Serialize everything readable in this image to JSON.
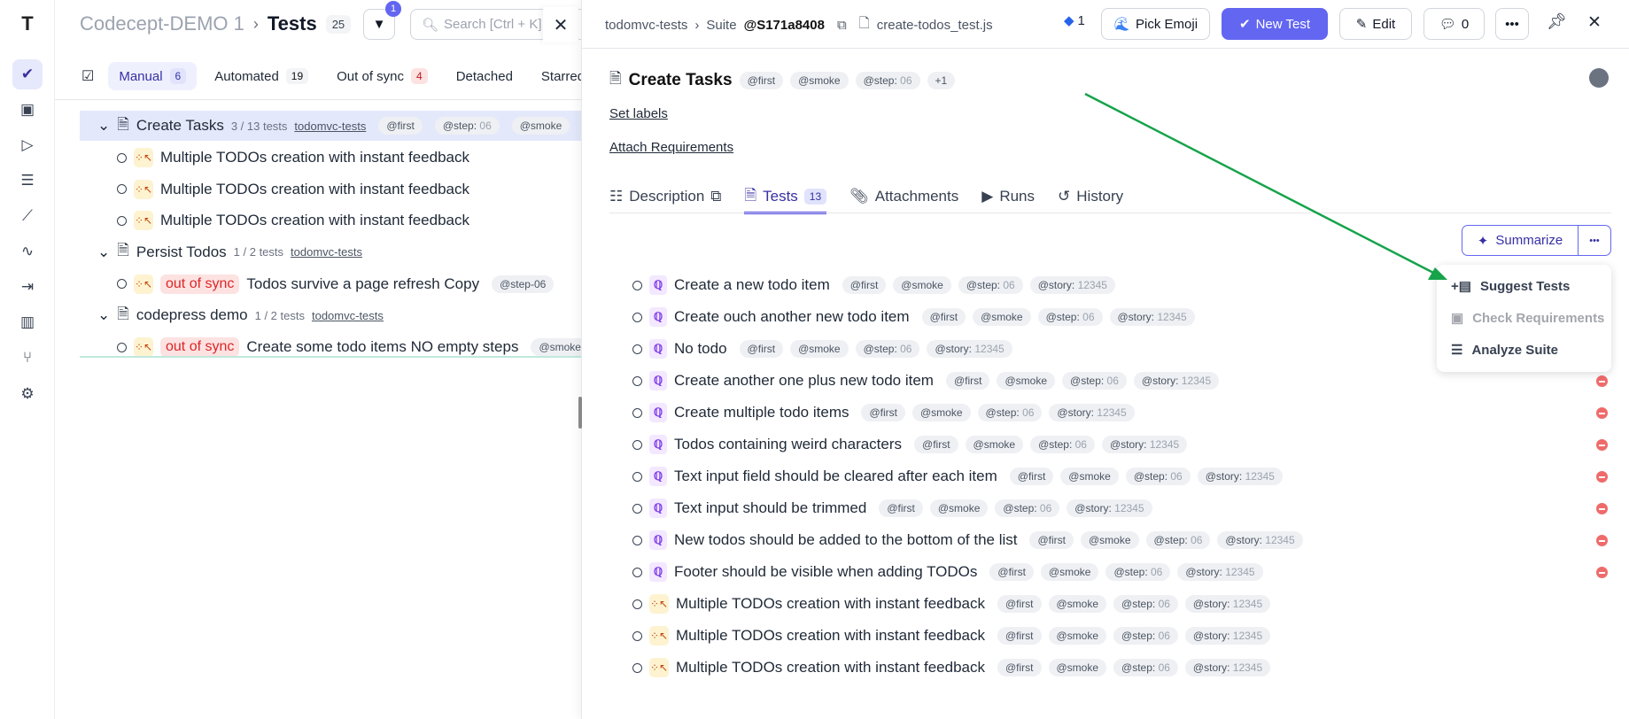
{
  "sidebar": {
    "items": [
      "logo",
      "tests",
      "suites",
      "runs",
      "plans",
      "steps",
      "analytics",
      "import",
      "reports",
      "branches",
      "settings"
    ]
  },
  "left": {
    "project": "Codecept-DEMO 1",
    "separator": "›",
    "title": "Tests",
    "count": "25",
    "filter_badge": "1",
    "search_placeholder": "Search [Ctrl + K]",
    "tabs": [
      {
        "label": "Manual",
        "count": "6"
      },
      {
        "label": "Automated",
        "count": "19"
      },
      {
        "label": "Out of sync",
        "count": "4"
      },
      {
        "label": "Detached"
      },
      {
        "label": "Starred"
      }
    ],
    "suites": [
      {
        "name": "Create Tasks",
        "meta": "3 / 13 tests",
        "link": "todomvc-tests",
        "tags": [
          [
            "@first",
            ""
          ],
          [
            "@step:",
            " 06"
          ],
          [
            "@smoke",
            ""
          ]
        ],
        "tests": [
          {
            "name": "Multiple TODOs creation with instant feedback"
          },
          {
            "name": "Multiple TODOs creation with instant feedback"
          },
          {
            "name": "Multiple TODOs creation with instant feedback"
          }
        ]
      },
      {
        "name": "Persist Todos",
        "meta": "1 / 2 tests",
        "link": "todomvc-tests",
        "tags": [],
        "tests": [
          {
            "name": "Todos survive a page refresh Copy",
            "oos": "out of sync",
            "tag": "@step-06"
          }
        ]
      },
      {
        "name": "codepress demo",
        "meta": "1 / 2 tests",
        "link": "todomvc-tests",
        "tags": [],
        "tests": [
          {
            "name": "Create some todo items NO empty steps",
            "oos": "out of sync",
            "tag": "@smoke"
          }
        ]
      }
    ]
  },
  "right": {
    "breadcrumb": {
      "project": "todomvc-tests",
      "suite_prefix": "Suite",
      "suite_id": "@S171a8408",
      "file": "create-todos_test.js"
    },
    "jira_count": "1",
    "pick_emoji": "Pick Emoji",
    "new_test": "New Test",
    "edit": "Edit",
    "comments": "0",
    "title": "Create Tasks",
    "title_tags": [
      [
        "@first",
        ""
      ],
      [
        "@smoke",
        ""
      ],
      [
        "@step:",
        " 06"
      ],
      [
        "+1",
        ""
      ]
    ],
    "set_labels": "Set labels",
    "attach_requirements": "Attach Requirements",
    "tabs": [
      {
        "label": "Description"
      },
      {
        "label": "Tests",
        "count": "13"
      },
      {
        "label": "Attachments"
      },
      {
        "label": "Runs"
      },
      {
        "label": "History"
      }
    ],
    "summarize": "Summarize",
    "menu": [
      {
        "label": "Suggest Tests",
        "disabled": false
      },
      {
        "label": "Check Requirements",
        "disabled": true
      },
      {
        "label": "Analyze Suite",
        "disabled": false
      }
    ],
    "tests": [
      {
        "name": "Create a new todo item",
        "type": "auto",
        "del": false
      },
      {
        "name": "Create ouch another new todo item",
        "type": "auto",
        "del": false
      },
      {
        "name": "No todo",
        "type": "auto",
        "del": false
      },
      {
        "name": "Create another one plus new todo item",
        "type": "auto",
        "del": true
      },
      {
        "name": "Create multiple todo items",
        "type": "auto",
        "del": true
      },
      {
        "name": "Todos containing weird characters",
        "type": "auto",
        "del": true
      },
      {
        "name": "Text input field should be cleared after each item",
        "type": "auto",
        "del": true
      },
      {
        "name": "Text input should be trimmed",
        "type": "auto",
        "del": true
      },
      {
        "name": "New todos should be added to the bottom of the list",
        "type": "auto",
        "del": true
      },
      {
        "name": "Footer should be visible when adding TODOs",
        "type": "auto",
        "del": true
      },
      {
        "name": "Multiple TODOs creation with instant feedback",
        "type": "manual",
        "del": false
      },
      {
        "name": "Multiple TODOs creation with instant feedback",
        "type": "manual",
        "del": false
      },
      {
        "name": "Multiple TODOs creation with instant feedback",
        "type": "manual",
        "del": false
      }
    ],
    "test_tags": [
      [
        "@first",
        ""
      ],
      [
        "@smoke",
        ""
      ],
      [
        "@step:",
        " 06"
      ],
      [
        "@story:",
        " 12345"
      ]
    ]
  },
  "colors": {
    "accent": "#5b5fe8",
    "annotation_arrow": "#16a34a",
    "danger": "#ef6b6b"
  }
}
